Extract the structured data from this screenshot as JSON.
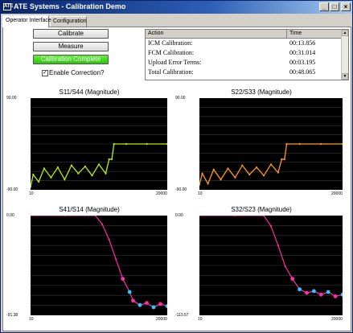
{
  "window": {
    "title": "ATE Systems - Calibration Demo",
    "icon_text": "ATE"
  },
  "title_buttons": {
    "minimize": "_",
    "maximize": "□",
    "close": "×"
  },
  "tabs": [
    {
      "label": "Operator Interface"
    },
    {
      "label": "Configuration"
    }
  ],
  "controls": {
    "calibrate_label": "Calibrate",
    "measure_label": "Measure",
    "status_label": "Calibration Complete",
    "enable_correction_label": "Enable Correction?",
    "enable_correction_checked": true
  },
  "timing_table": {
    "columns": [
      "Action",
      "Time"
    ],
    "rows": [
      {
        "action": "ICM Calibration:",
        "time": "00:13.856"
      },
      {
        "action": "FCM Calibration:",
        "time": "00:31.014"
      },
      {
        "action": "Upload Error Terms:",
        "time": "00:03.195"
      },
      {
        "action": "Total Calibration:",
        "time": "00:48.065"
      }
    ]
  },
  "colors": {
    "plot_bg": "#000000",
    "trace_s11": "#b8f000",
    "trace_s22": "#ff9a10",
    "trace_s41": "#ff2ea6",
    "trace_s32": "#ff2ea6",
    "noise_alt": "#2ec7ff",
    "status_green": "#2ec210"
  },
  "chart_data": [
    {
      "type": "line",
      "title": "S11/S44 (Magnitude)",
      "ylim": [
        -90.0,
        90.0
      ],
      "y_tick_labels": [
        "90.00",
        "-90.00"
      ],
      "x_tick_labels": [
        "10",
        "20000"
      ],
      "grid": true,
      "x": [
        10,
        400,
        1200,
        2000,
        3000,
        4000,
        5000,
        6000,
        7000,
        8000,
        9000,
        10000,
        11000,
        11500,
        11900,
        12200,
        14000,
        17000,
        20000
      ],
      "series": [
        {
          "values": [
            -84,
            -60,
            -74,
            -48,
            -66,
            -46,
            -70,
            -42,
            -58,
            -44,
            -62,
            -40,
            -58,
            -30,
            -30,
            0,
            0,
            0,
            0
          ]
        }
      ]
    },
    {
      "type": "line",
      "title": "S22/S33 (Magnitude)",
      "ylim": [
        -90.0,
        90.0
      ],
      "y_tick_labels": [
        "90.00",
        "-90.00"
      ],
      "x_tick_labels": [
        "10",
        "20000"
      ],
      "grid": true,
      "x": [
        10,
        400,
        1200,
        2000,
        3000,
        4000,
        5000,
        6000,
        7000,
        8000,
        9000,
        10000,
        11000,
        11500,
        11900,
        12200,
        14000,
        17000,
        20000
      ],
      "series": [
        {
          "values": [
            -80,
            -58,
            -78,
            -50,
            -70,
            -48,
            -66,
            -42,
            -60,
            -46,
            -62,
            -40,
            -56,
            -30,
            -30,
            0,
            0,
            0,
            0
          ]
        }
      ]
    },
    {
      "type": "line",
      "title": "S41/S14 (Magnitude)",
      "ylim": [
        -91.38,
        0.0
      ],
      "y_tick_labels": [
        "0.00",
        "-91.38"
      ],
      "x_tick_labels": [
        "10",
        "20000"
      ],
      "grid": true,
      "x": [
        10,
        5000,
        9500,
        10500,
        11500,
        12500,
        13500,
        14500,
        15000,
        16000,
        17000,
        18000,
        19000,
        20000
      ],
      "series": [
        {
          "values": [
            0,
            0,
            0,
            -8,
            -22,
            -40,
            -58,
            -70,
            -78,
            -82,
            -80,
            -84,
            -81,
            -83
          ]
        }
      ]
    },
    {
      "type": "line",
      "title": "S32/S23 (Magnitude)",
      "ylim": [
        -113.57,
        0.0
      ],
      "y_tick_labels": [
        "0.00",
        "-113.57"
      ],
      "x_tick_labels": [
        "10",
        "20000"
      ],
      "grid": true,
      "x": [
        10,
        5000,
        9000,
        10000,
        11000,
        12000,
        13000,
        14000,
        15000,
        16000,
        17000,
        18000,
        19000,
        20000
      ],
      "series": [
        {
          "values": [
            0,
            0,
            0,
            -12,
            -34,
            -58,
            -72,
            -84,
            -88,
            -86,
            -90,
            -87,
            -92,
            -90
          ]
        }
      ]
    }
  ]
}
